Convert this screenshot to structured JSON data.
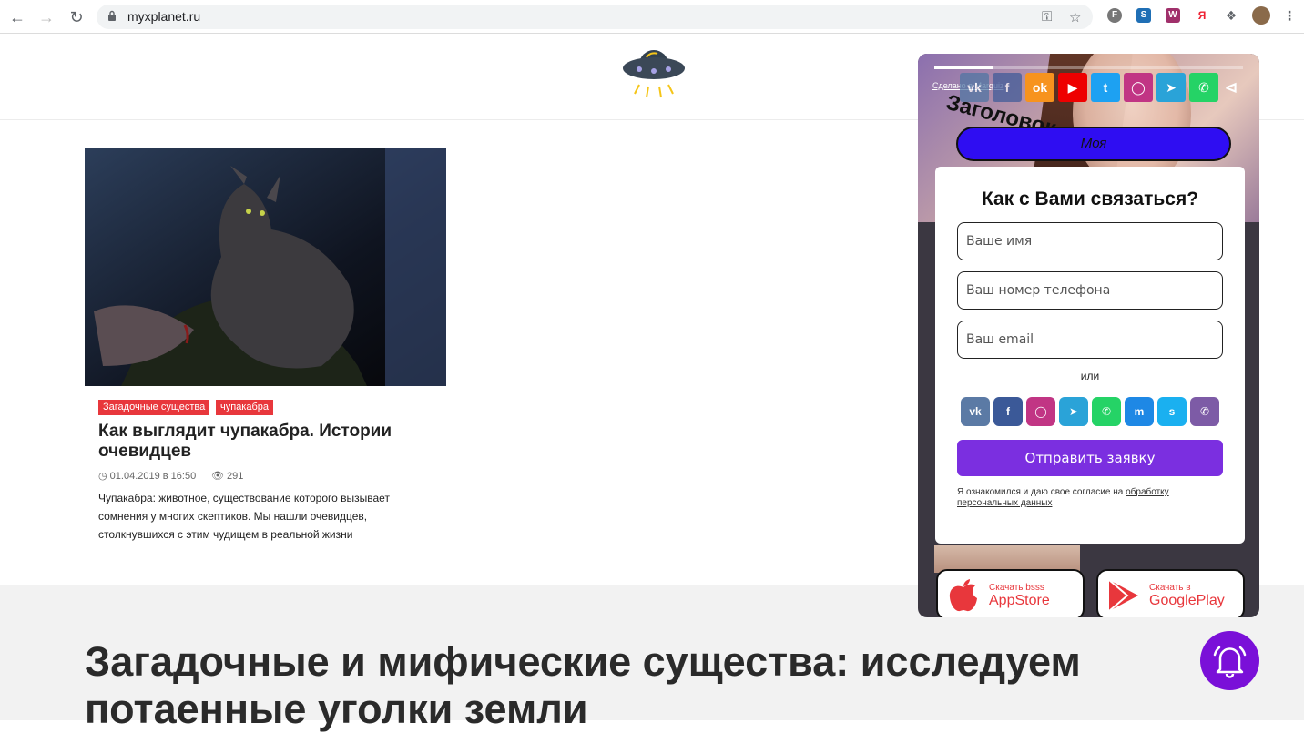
{
  "browser": {
    "url": "myxplanet.ru"
  },
  "article": {
    "tags": [
      "Загадочные существа",
      "чупакабра"
    ],
    "title": "Как выглядит чупакабра. Истории очевидцев",
    "date": "01.04.2019 в 16:50",
    "views": "291",
    "excerpt": "Чупакабра: животное, существование которого вызывает сомнения у многих скептиков. Мы нашли очевидцев, столкнувшихся с этим чудищем в реальной жизни"
  },
  "section": {
    "heading": "Загадочные и мифические существа: исследуем потаенные уголки земли"
  },
  "widget": {
    "made_with": "Сделано в Marquiz",
    "headline": "Заголовок",
    "pill_label": "Моя",
    "form_title": "Как с Вами связаться?",
    "name_placeholder": "Ваше имя",
    "phone_placeholder": "Ваш номер телефона",
    "email_placeholder": "Ваш email",
    "or_label": "или",
    "submit_label": "Отправить заявку",
    "consent_text": "Я ознакомился и даю свое согласие на ",
    "consent_link": "обработку персональных данных",
    "appstore_small": "Скачать bsss",
    "appstore_big": "AppStore",
    "googleplay_small": "Скачать в",
    "googleplay_big": "GooglePlay",
    "progress": 0.19
  },
  "colors": {
    "accent_purple": "#7b2fe0",
    "tag_red": "#e8373c",
    "pill_blue": "#2f0df2"
  }
}
